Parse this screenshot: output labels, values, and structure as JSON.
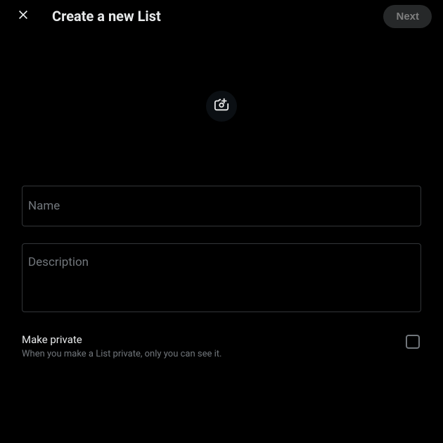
{
  "header": {
    "title": "Create a new List",
    "next_label": "Next"
  },
  "fields": {
    "name_label": "Name",
    "description_label": "Description"
  },
  "privacy": {
    "title": "Make private",
    "subtitle": "When you make a List private, only you can see it.",
    "checked": false
  }
}
